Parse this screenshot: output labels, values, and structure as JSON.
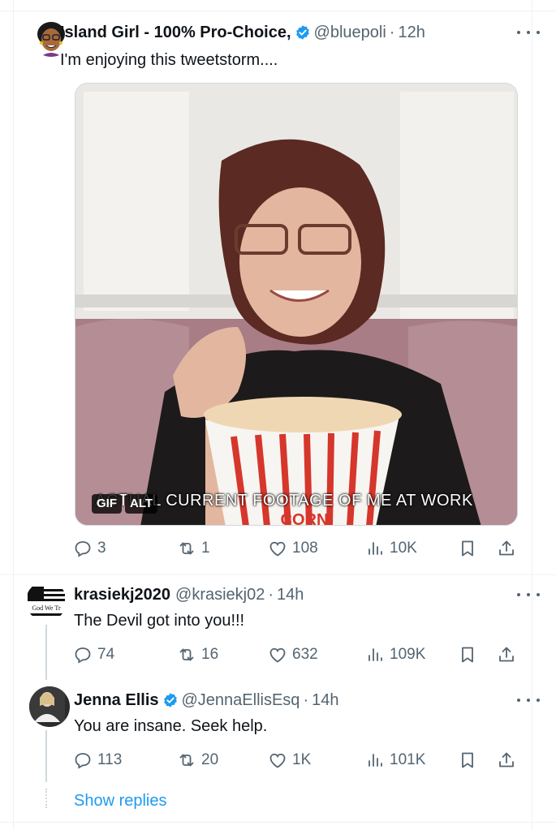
{
  "posts": [
    {
      "name": "Island Girl - 100% Pro-Choice,",
      "handle": "@bluepoli",
      "time": "12h",
      "text": "I'm enjoying this tweetstorm....",
      "media": {
        "caption": "ACTUAL CURRENT FOOTAGE OF ME AT WORK",
        "badges": [
          "GIF",
          "ALT"
        ],
        "popcorn_label": "CORN"
      },
      "stats": {
        "replies": "3",
        "reposts": "1",
        "likes": "108",
        "views": "10K"
      }
    },
    {
      "name": "krasiekj2020",
      "handle": "@krasiekj02",
      "time": "14h",
      "text": "The Devil got into you!!!",
      "stats": {
        "replies": "74",
        "reposts": "16",
        "likes": "632",
        "views": "109K"
      }
    },
    {
      "name": "Jenna Ellis",
      "handle": "@JennaEllisEsq",
      "time": "14h",
      "text": "You are insane. Seek help.",
      "stats": {
        "replies": "113",
        "reposts": "20",
        "likes": "1K",
        "views": "101K"
      }
    }
  ],
  "show_replies_label": "Show replies",
  "dot_separator": "·",
  "colors": {
    "accent": "#1d9bf0",
    "text": "#0f1419",
    "secondary": "#536471",
    "border": "#eff3f4"
  },
  "icons": [
    "verified-badge-icon",
    "more-icon",
    "reply-icon",
    "repost-icon",
    "like-icon",
    "views-icon",
    "bookmark-icon",
    "share-icon"
  ]
}
